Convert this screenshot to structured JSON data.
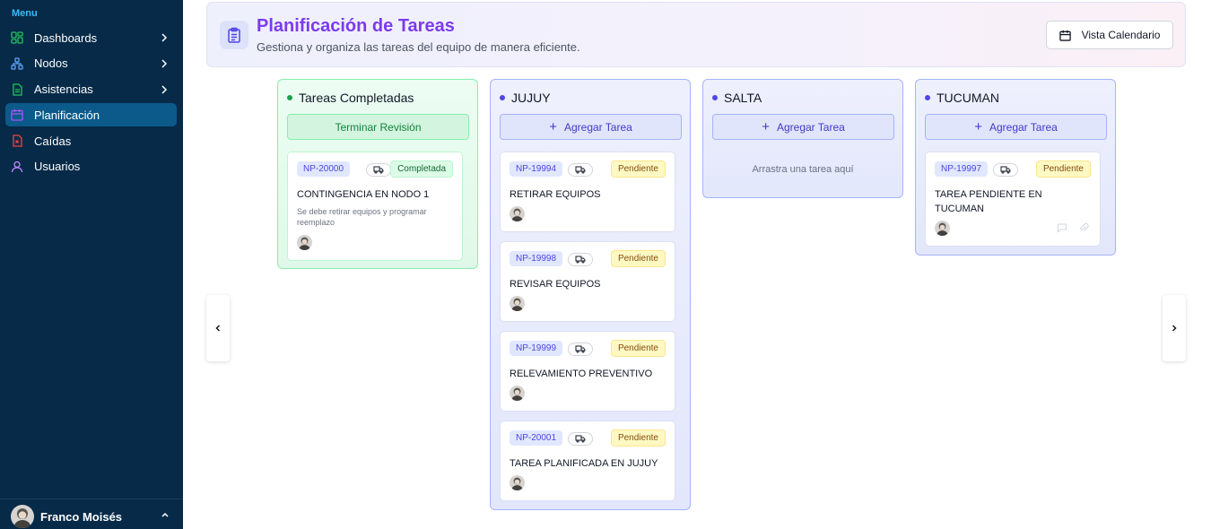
{
  "sidebar": {
    "heading": "Menu",
    "items": [
      {
        "label": "Dashboards",
        "icon": "dashboard-icon",
        "color": "#22c55e",
        "expandable": true
      },
      {
        "label": "Nodos",
        "icon": "nodes-icon",
        "color": "#60a5fa",
        "expandable": true
      },
      {
        "label": "Asistencias",
        "icon": "file-icon",
        "color": "#22c55e",
        "expandable": true
      },
      {
        "label": "Planificación",
        "icon": "calendar-icon",
        "color": "#a855f7",
        "expandable": false,
        "active": true
      },
      {
        "label": "Caídas",
        "icon": "file-alert-icon",
        "color": "#ef4444",
        "expandable": false
      },
      {
        "label": "Usuarios",
        "icon": "user-icon",
        "color": "#c084fc",
        "expandable": false
      }
    ],
    "user": {
      "name": "Franco Moisés"
    }
  },
  "header": {
    "title": "Planificación de Tareas",
    "subtitle": "Gestiona y organiza las tareas del equipo de manera eficiente.",
    "calendar_button": "Vista Calendario"
  },
  "columns": [
    {
      "name": "Tareas Completadas",
      "button": "Terminar Revisión",
      "variant": "done",
      "cards": [
        {
          "code": "NP-20000",
          "status": "Completada",
          "title": "CONTINGENCIA EN NODO 1",
          "description": "Se debe retirar equipos y programar reemplazo"
        }
      ]
    },
    {
      "name": "JUJUY",
      "button": "Agregar Tarea",
      "variant": "region",
      "cards": [
        {
          "code": "NP-19994",
          "status": "Pendiente",
          "title": "RETIRAR EQUIPOS"
        },
        {
          "code": "NP-19998",
          "status": "Pendiente",
          "title": "REVISAR EQUIPOS"
        },
        {
          "code": "NP-19999",
          "status": "Pendiente",
          "title": "RELEVAMIENTO PREVENTIVO"
        },
        {
          "code": "NP-20001",
          "status": "Pendiente",
          "title": "TAREA PLANIFICADA EN JUJUY"
        }
      ]
    },
    {
      "name": "SALTA",
      "button": "Agregar Tarea",
      "variant": "region",
      "empty_hint": "Arrastra una tarea aquí",
      "cards": []
    },
    {
      "name": "TUCUMAN",
      "button": "Agregar Tarea",
      "variant": "region",
      "cards": [
        {
          "code": "NP-19997",
          "status": "Pendiente",
          "title": "TAREA PENDIENTE EN TUCUMAN"
        }
      ]
    }
  ],
  "colors": {
    "sidebar_bg": "#062a48",
    "accent": "#7c3aed",
    "region_accent": "#4f46e5",
    "done_accent": "#16a34a",
    "pending_badge": "#fef9c3"
  }
}
